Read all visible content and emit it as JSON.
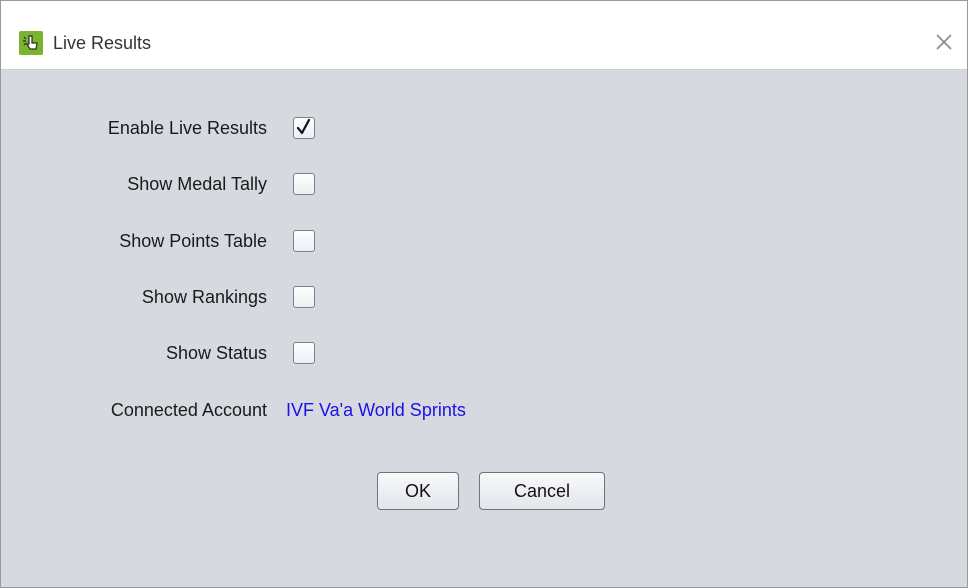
{
  "window": {
    "title": "Live Results",
    "icon": "live-results-app-icon",
    "close_icon": "close-icon"
  },
  "options": [
    {
      "label": "Enable Live Results",
      "checked": true
    },
    {
      "label": "Show Medal Tally",
      "checked": false
    },
    {
      "label": "Show Points Table",
      "checked": false
    },
    {
      "label": "Show Rankings",
      "checked": false
    },
    {
      "label": "Show Status",
      "checked": false
    }
  ],
  "account": {
    "label": "Connected Account",
    "value": "IVF Va'a World Sprints"
  },
  "buttons": {
    "ok": "OK",
    "cancel": "Cancel"
  },
  "colors": {
    "background": "#d6d9df",
    "link": "#1a12e6",
    "icon_green": "#7bb32e"
  }
}
